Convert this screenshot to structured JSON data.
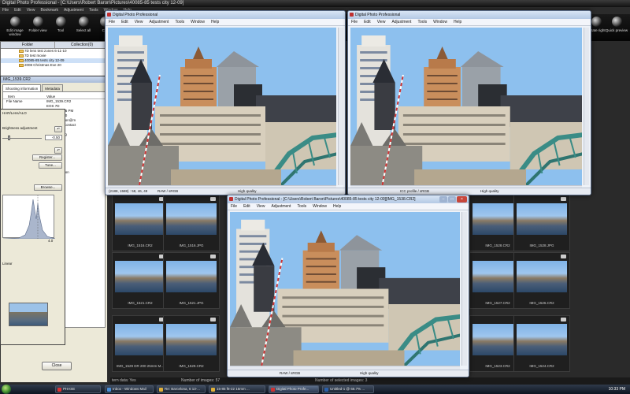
{
  "main_window": {
    "title": "Digital Photo Professional - [C:\\Users\\Robert Baron\\Pictures\\40085-85 tests city 12-09]",
    "menu": [
      "File",
      "Edit",
      "View",
      "Bookmark",
      "Adjustment",
      "Tools",
      "Window",
      "Help"
    ],
    "toolbar_left": [
      "Edit image window",
      "Folder view",
      "Tool",
      "Select all",
      "Cle"
    ],
    "toolbar_right": [
      "Rotate right",
      "Quick preview"
    ]
  },
  "folder_panel": {
    "tabs": [
      "Folder",
      "Collection(0)"
    ],
    "items": [
      "7D lens test zones 6-11-10",
      "7D test movie",
      "40085-85 tests city 12-09",
      "2008 Christmas Eve 20"
    ]
  },
  "info_window": {
    "title": "IMG_1539.CR2",
    "tabs": [
      "Shooting information",
      "Metadata"
    ],
    "headers": [
      "Item",
      "Value"
    ],
    "rows": [
      [
        "File Name",
        "IMG_1539.CR2"
      ],
      [
        "",
        "EOS 7D"
      ],
      [
        "",
        "2009 2:03:26 PM"
      ],
      [
        "",
        "Version 1.1.0"
      ],
      [
        "",
        "Baron robaron@m"
      ],
      [
        "",
        "Reserved. Contact"
      ],
      [
        "",
        "Exposure"
      ],
      [
        "",
        "tive Metering"
      ],
      [
        "",
        "t"
      ],
      [
        "",
        "ISO"
      ],
      [
        "",
        "1/2 8, USM"
      ],
      [
        "",
        "56"
      ],
      [
        "",
        "l focusing"
      ],
      [
        "",
        "l selection"
      ],
      [
        "",
        "Operation"
      ],
      [
        "",
        "mer Operation"
      ],
      [
        "",
        "03072"
      ]
    ],
    "close_label": "Close"
  },
  "tool_palette": {
    "labels": [
      "HAR/Lens/ALO",
      "Brightness adjustment",
      "Register...",
      "Tune...",
      "Linear",
      "Browse..."
    ],
    "brightness_value": "-0.50",
    "axis_label": "4.0"
  },
  "thumbnails": [
    {
      "name": "IMG_1516.CR2"
    },
    {
      "name": "IMG_1516.JPG"
    },
    {
      "name": "IMG_1528.CR2"
    },
    {
      "name": "IMG_1528.JPG"
    },
    {
      "name": "IMG_1521.CR2"
    },
    {
      "name": "IMG_1521.JPG"
    },
    {
      "name": "IMG_1527.CR2"
    },
    {
      "name": "IMG_1526.CR2"
    },
    {
      "name": "IMG_1529 DR 200 25mm M..."
    },
    {
      "name": "IMG_1529.CR2"
    },
    {
      "name": "IMG_1523.CR2"
    },
    {
      "name": "IMG_1524.CR2"
    }
  ],
  "main_status": {
    "left": "tern data: Yes",
    "center": "Number of images: 57",
    "right": "Number of selected images: 3"
  },
  "photo_windows": {
    "left": {
      "title": "Digital Photo Professional",
      "menu": [
        "File",
        "Edit",
        "View",
        "Adjustment",
        "Tools",
        "Window",
        "Help"
      ],
      "status_left": "(2188, 1588) : 58, 46, 49",
      "status_mid": "RAW / sRGB",
      "status_right": "High quality"
    },
    "right": {
      "title": "Digital Photo Professional",
      "menu": [
        "File",
        "Edit",
        "View",
        "Adjustment",
        "Tools",
        "Window",
        "Help"
      ],
      "status_mid": "ICC profile / sRGB",
      "status_right": "High quality"
    },
    "bottom": {
      "title": "Digital Photo Professional - [C:\\Users\\Robert Baron\\Pictures\\40085-85 tests city 12-09][IMG_1538.CR2]",
      "menu": [
        "File",
        "Edit",
        "View",
        "Adjustment",
        "Tools",
        "Window",
        "Help"
      ],
      "status_mid": "RAW / sRGB",
      "status_right": "High quality"
    }
  },
  "taskbar": {
    "items": [
      "PHASE",
      "Inbox - Windows Mail",
      "Re: Barcelona, 6 13-...",
      "15-85 f8-22 15mm ...",
      "Digital Photo Profe...",
      "Untitled-1 @ 66.7% ..."
    ],
    "clock": "10:33 PM"
  },
  "colors": {
    "app_background": "#2a2a2a",
    "sky": "#8fc2f0",
    "title_gradient": "#b4c9e4",
    "taskbar": "#1e2836"
  }
}
